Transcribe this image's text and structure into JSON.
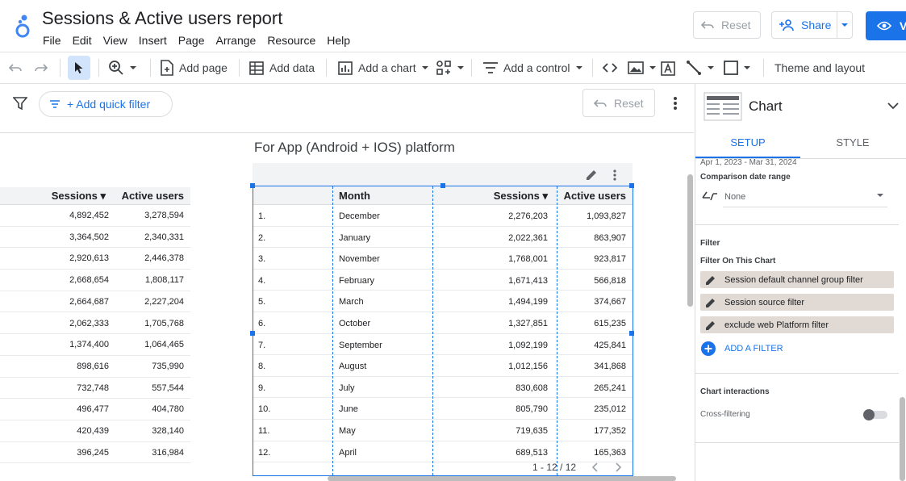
{
  "header": {
    "title": "Sessions & Active users report",
    "menu": [
      "File",
      "Edit",
      "View",
      "Insert",
      "Page",
      "Arrange",
      "Resource",
      "Help"
    ],
    "reset_label": "Reset",
    "share_label": "Share",
    "view_label": "V"
  },
  "toolbar": {
    "add_page": "Add page",
    "add_data": "Add data",
    "add_chart": "Add a chart",
    "add_control": "Add a control",
    "theme_layout": "Theme and layout"
  },
  "filterbar": {
    "quick_filter": "+ Add quick filter",
    "reset_label": "Reset"
  },
  "left_table": {
    "headers": [
      "Sessions ▾",
      "Active users"
    ],
    "rows": [
      [
        "4,892,452",
        "3,278,594"
      ],
      [
        "3,364,502",
        "2,340,331"
      ],
      [
        "2,920,613",
        "2,446,378"
      ],
      [
        "2,668,654",
        "1,808,117"
      ],
      [
        "2,664,687",
        "2,227,204"
      ],
      [
        "2,062,333",
        "1,705,768"
      ],
      [
        "1,374,400",
        "1,064,465"
      ],
      [
        "898,616",
        "735,990"
      ],
      [
        "732,748",
        "557,544"
      ],
      [
        "496,477",
        "404,780"
      ],
      [
        "420,439",
        "328,140"
      ],
      [
        "396,245",
        "316,984"
      ]
    ]
  },
  "center_table": {
    "title": "For App (Android + IOS) platform",
    "headers": [
      "Month",
      "Sessions ▾",
      "Active users"
    ],
    "rows": [
      [
        "1.",
        "December",
        "2,276,203",
        "1,093,827"
      ],
      [
        "2.",
        "January",
        "2,022,361",
        "863,907"
      ],
      [
        "3.",
        "November",
        "1,768,001",
        "923,817"
      ],
      [
        "4.",
        "February",
        "1,671,413",
        "566,818"
      ],
      [
        "5.",
        "March",
        "1,494,199",
        "374,667"
      ],
      [
        "6.",
        "October",
        "1,327,851",
        "615,235"
      ],
      [
        "7.",
        "September",
        "1,092,199",
        "425,841"
      ],
      [
        "8.",
        "August",
        "1,012,156",
        "341,868"
      ],
      [
        "9.",
        "July",
        "830,608",
        "265,241"
      ],
      [
        "10.",
        "June",
        "805,790",
        "235,012"
      ],
      [
        "11.",
        "May",
        "719,635",
        "177,352"
      ],
      [
        "12.",
        "April",
        "689,513",
        "165,363"
      ]
    ],
    "pager": "1 - 12 / 12"
  },
  "panel": {
    "title": "Chart",
    "tab_setup": "SETUP",
    "tab_style": "STYLE",
    "date_range": "Apr 1, 2023 - Mar 31, 2024",
    "comparison_label": "Comparison date range",
    "comparison_value": "None",
    "filter_heading": "Filter",
    "filter_on_chart": "Filter On This Chart",
    "filters": [
      "Session default channel group filter",
      "Session source filter",
      "exclude web Platform filter"
    ],
    "add_filter": "ADD A FILTER",
    "interactions_heading": "Chart interactions",
    "cross_filtering": "Cross-filtering"
  },
  "colors": {
    "accent": "#1a73e8",
    "chip_bg": "#e0d9d4",
    "header_bg": "#f1f3f4"
  }
}
